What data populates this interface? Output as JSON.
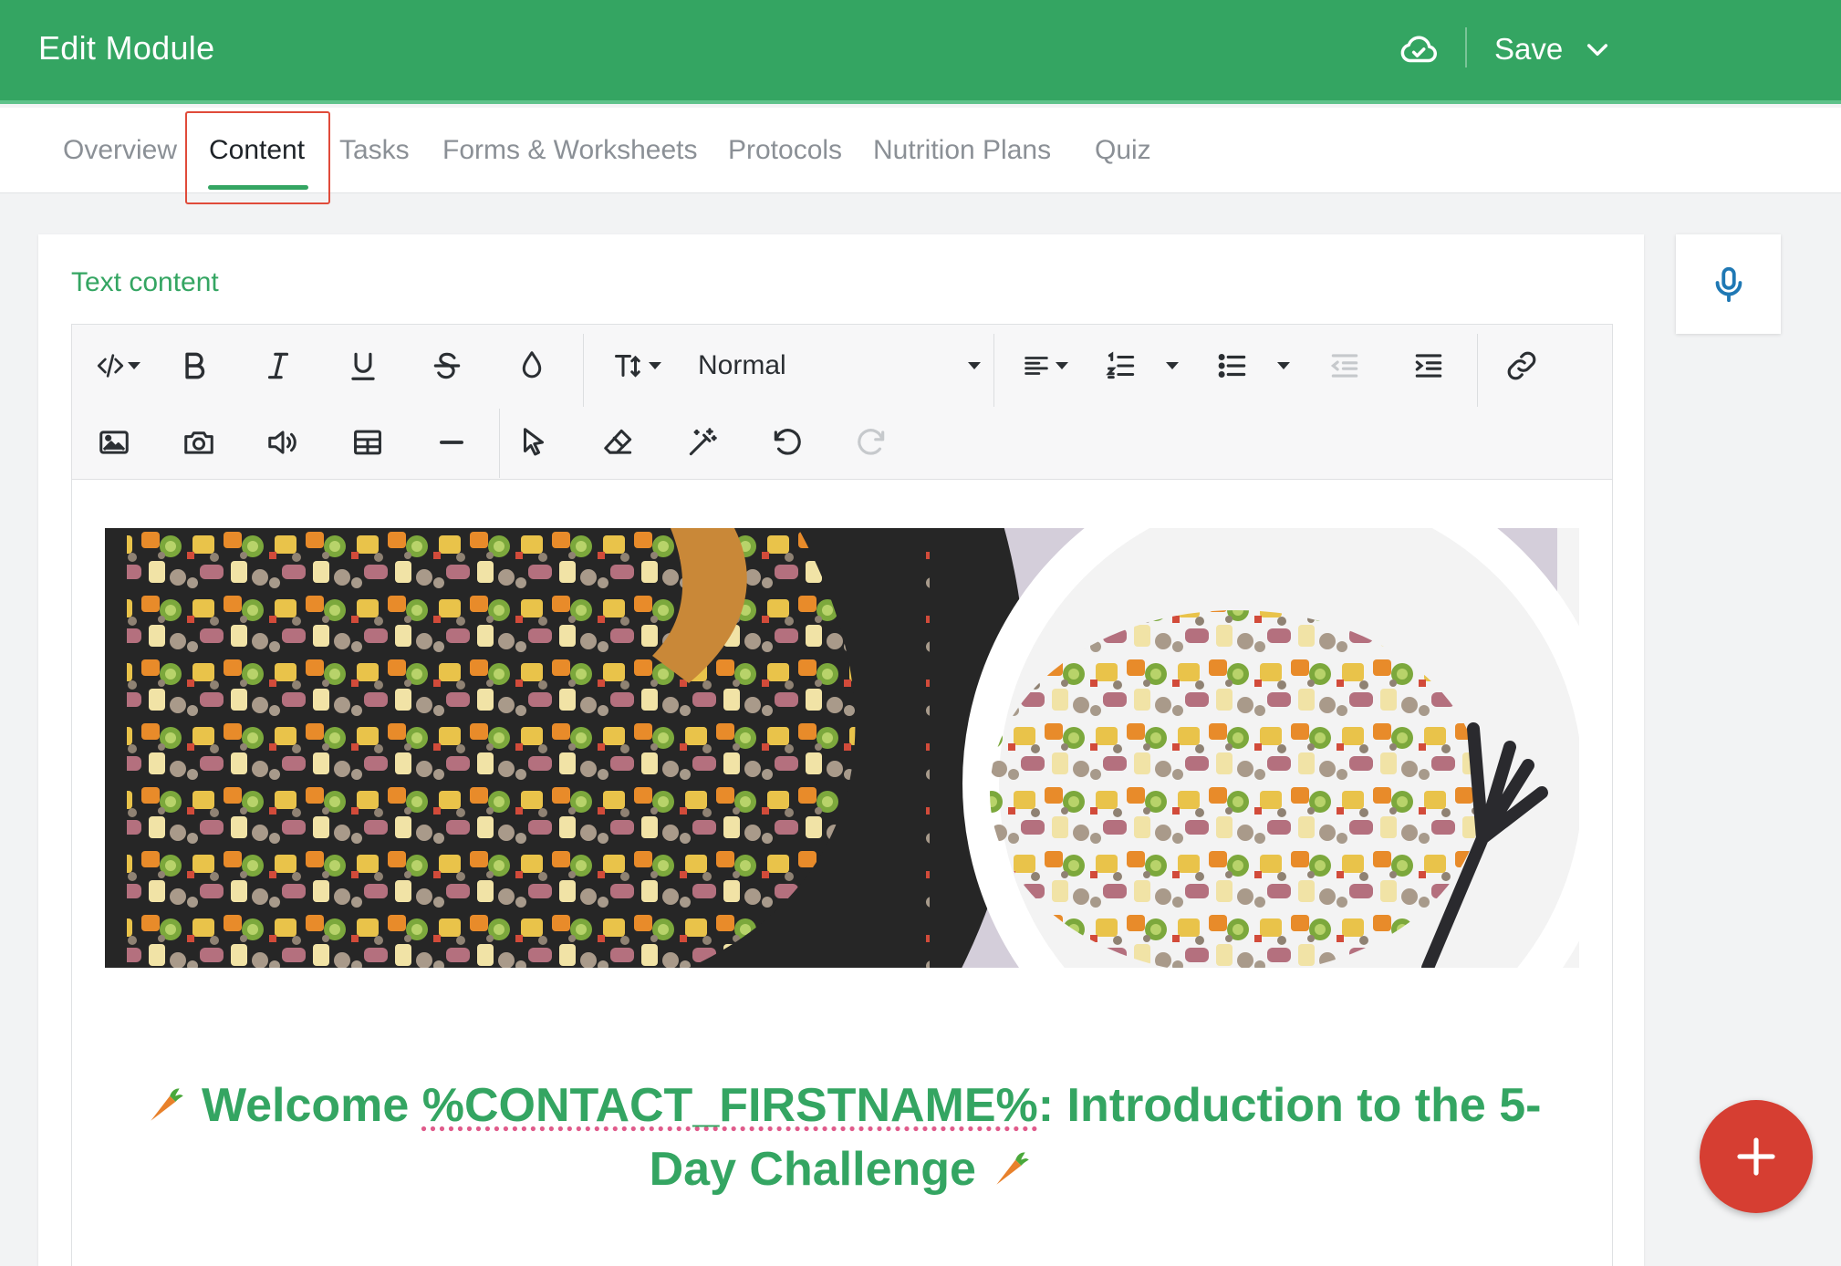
{
  "header": {
    "title": "Edit Module",
    "save_label": "Save"
  },
  "tabs": [
    {
      "label": "Overview"
    },
    {
      "label": "Content"
    },
    {
      "label": "Tasks"
    },
    {
      "label": "Forms & Worksheets"
    },
    {
      "label": "Protocols"
    },
    {
      "label": "Nutrition Plans"
    },
    {
      "label": "Quiz"
    }
  ],
  "active_tab": "Content",
  "editor": {
    "section_label": "Text content",
    "format_value": "Normal",
    "heading_prefix": "Welcome ",
    "heading_merge_tag": "%CONTACT_FIRSTNAME%",
    "heading_suffix": ": Introduction to the 5-Day Challenge"
  },
  "icons": {
    "header": [
      "cloud-check-icon",
      "chevron-down-icon"
    ],
    "toolbar_row1": [
      "code-icon",
      "bold-icon",
      "italic-icon",
      "underline-icon",
      "strikethrough-icon",
      "text-color-icon",
      "font-size-icon",
      "align-left-icon",
      "ordered-list-icon",
      "bullet-list-icon",
      "outdent-icon",
      "indent-icon",
      "link-icon"
    ],
    "toolbar_row2": [
      "image-icon",
      "camera-icon",
      "audio-icon",
      "table-icon",
      "horizontal-rule-icon",
      "select-pointer-icon",
      "eraser-icon",
      "magic-wand-icon",
      "undo-icon",
      "redo-icon"
    ],
    "side": [
      "microphone-icon",
      "plus-icon"
    ],
    "emoji": "carrot-icon"
  },
  "colors": {
    "brand_green": "#34a562",
    "fab_red": "#d63e32",
    "mic_blue": "#1f78b4",
    "highlight_red": "#e04b3a"
  }
}
